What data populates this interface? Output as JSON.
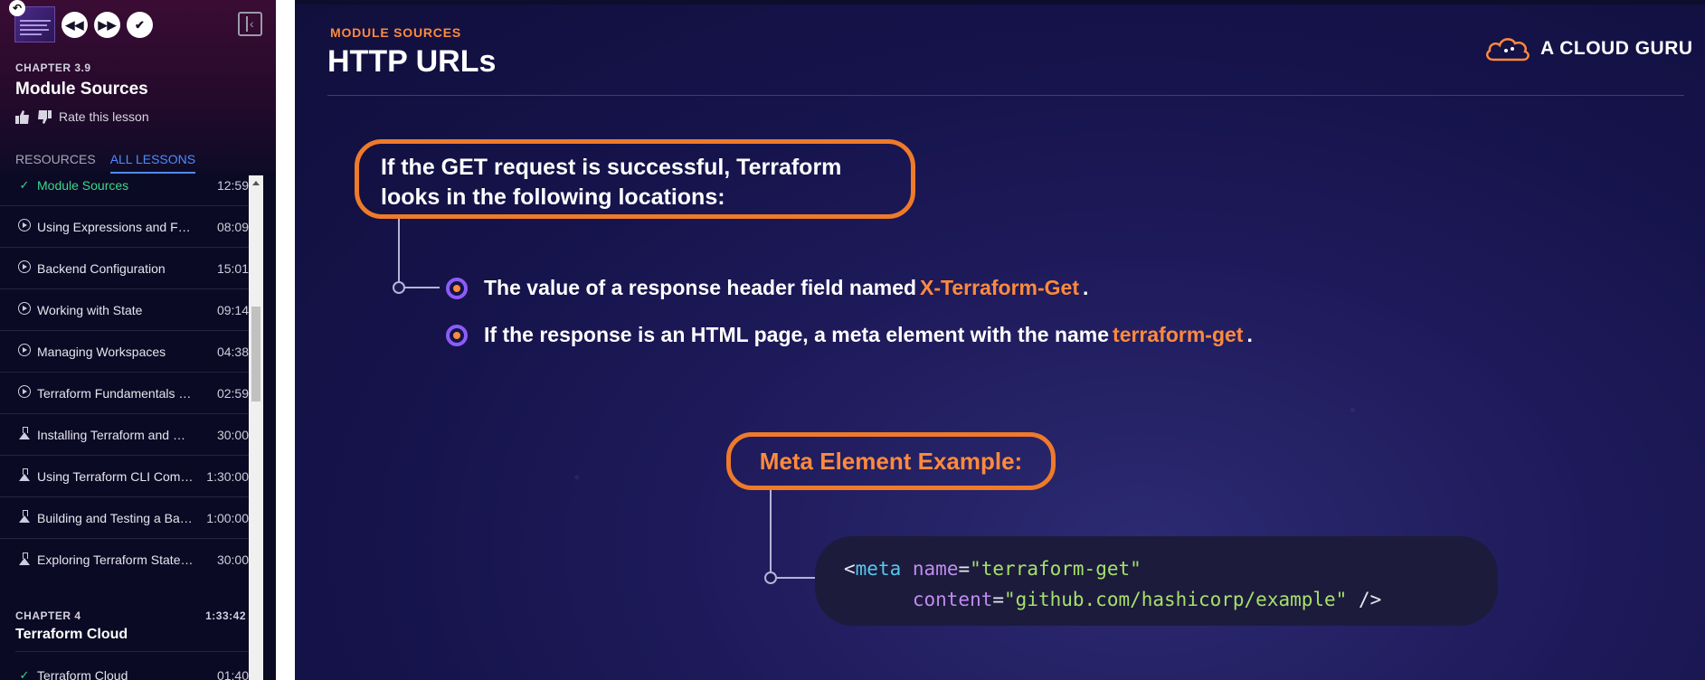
{
  "sidebar": {
    "chapter_label": "CHAPTER 3.9",
    "lesson_title": "Module Sources",
    "rate_label": "Rate this lesson",
    "tabs": [
      {
        "label": "RESOURCES",
        "active": false
      },
      {
        "label": "ALL LESSONS",
        "active": true
      }
    ],
    "lessons": [
      {
        "name": "Module Sources",
        "duration": "12:59",
        "icon": "check-icon",
        "done": true
      },
      {
        "name": "Using Expressions and Functi...",
        "duration": "08:09",
        "icon": "play-circle-icon"
      },
      {
        "name": "Backend Configuration",
        "duration": "15:01",
        "icon": "play-circle-icon"
      },
      {
        "name": "Working with State",
        "duration": "09:14",
        "icon": "play-circle-icon"
      },
      {
        "name": "Managing Workspaces",
        "duration": "04:38",
        "icon": "play-circle-icon"
      },
      {
        "name": "Terraform Fundamentals (Sec...",
        "duration": "02:59",
        "icon": "play-circle-icon"
      },
      {
        "name": "Installing Terraform and Work...",
        "duration": "30:00",
        "icon": "flask-icon"
      },
      {
        "name": "Using Terraform CLI Comma...",
        "duration": "1:30:00",
        "icon": "flask-icon"
      },
      {
        "name": "Building and Testing a Basic ...",
        "duration": "1:00:00",
        "icon": "flask-icon"
      },
      {
        "name": "Exploring Terraform State Fun...",
        "duration": "30:00",
        "icon": "flask-icon"
      }
    ],
    "chapter4": {
      "label": "CHAPTER 4",
      "duration": "1:33:42",
      "title": "Terraform Cloud",
      "first_lesson": {
        "name": "Terraform Cloud",
        "duration": "01:40"
      }
    }
  },
  "slide": {
    "module_label": "MODULE SOURCES",
    "title": "HTTP URLs",
    "brand": "A CLOUD GURU",
    "callout1_line1": "If the GET request is successful, Terraform",
    "callout1_line2": "looks in the following locations:",
    "bullet1_text": "The value of a response header field named",
    "bullet1_highlight": "X-Terraform-Get",
    "bullet1_end": ".",
    "bullet2_text": "If the response is an HTML page, a meta element with the name",
    "bullet2_highlight": "terraform-get",
    "bullet2_end": ".",
    "callout2": "Meta Element Example:",
    "code": {
      "open": "<",
      "tag": "meta",
      "attr1": "name",
      "val1": "\"terraform-get\"",
      "attr2": "content",
      "val2": "\"github.com/hashicorp/example\"",
      "close": " />",
      "eq": "="
    }
  },
  "colors": {
    "accent_orange": "#ff8a3d",
    "active_tab": "#4f8bff",
    "done_green": "#39d98a",
    "bullet_purple": "#8b5cf6"
  }
}
